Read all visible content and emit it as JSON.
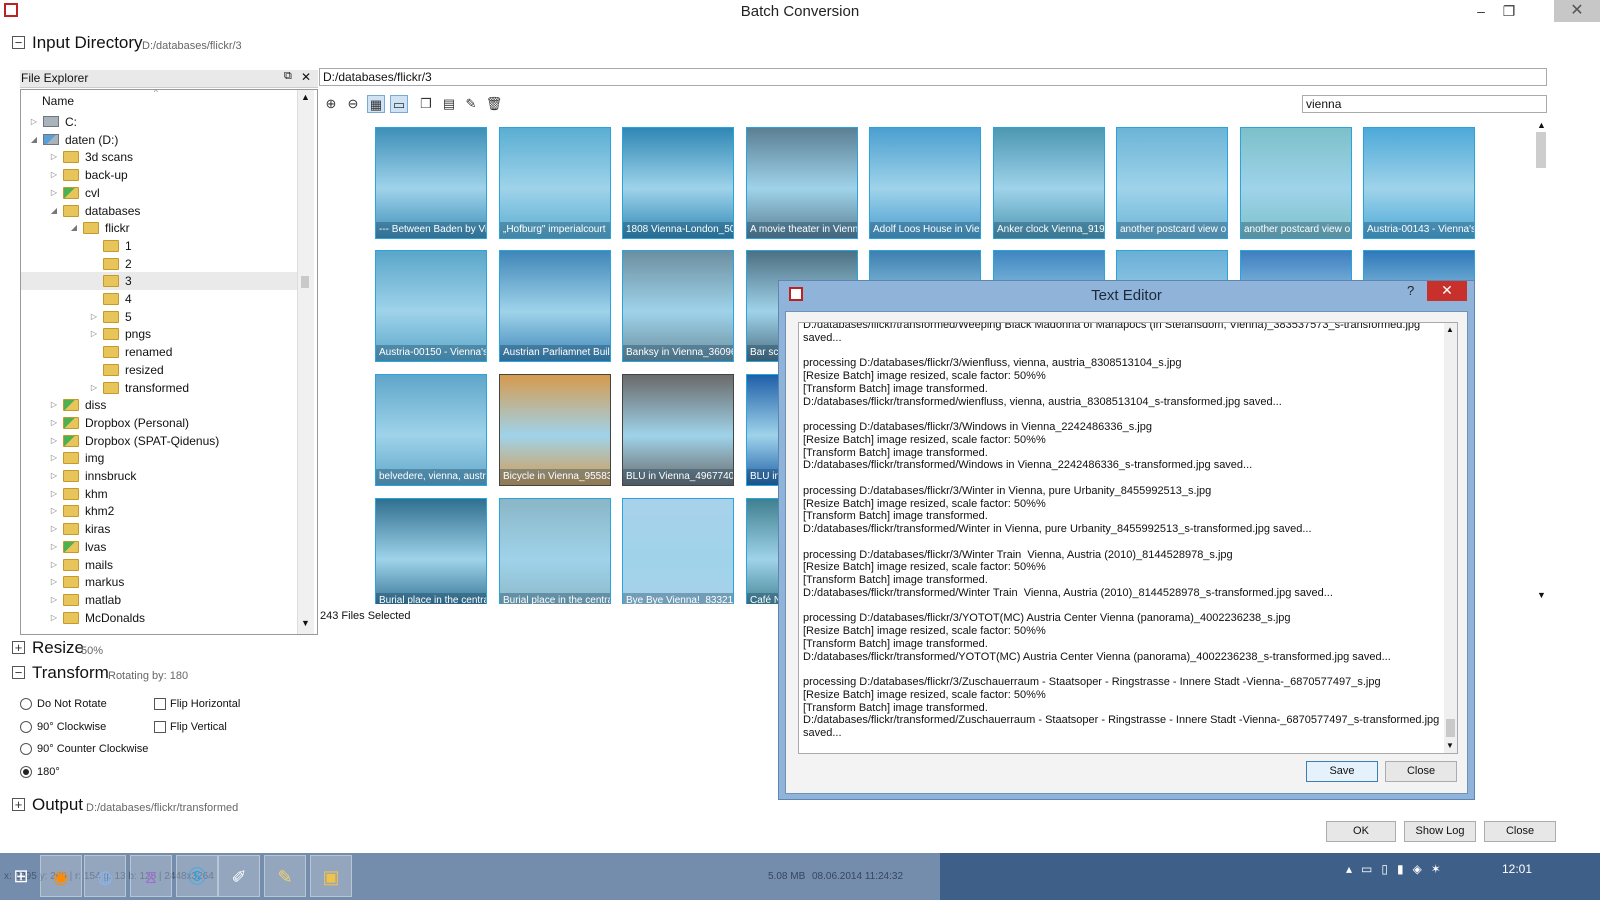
{
  "window": {
    "title": "Batch Conversion",
    "min_label": "–",
    "max_label": "❐",
    "close_label": "✕"
  },
  "sections": {
    "input": {
      "toggle": "−",
      "title": "Input Directory",
      "path": "D:/databases/flickr/3"
    },
    "resize": {
      "toggle": "+",
      "title": "Resize",
      "value": "50%"
    },
    "transform": {
      "toggle": "−",
      "title": "Transform",
      "value": "Rotating by: 180"
    },
    "output": {
      "toggle": "+",
      "title": "Output",
      "path": "D:/databases/flickr/transformed"
    }
  },
  "file_explorer": {
    "title": "File Explorer",
    "column": "Name",
    "items": [
      {
        "label": "C:",
        "icon": "drive-icon",
        "arrow": "▷"
      },
      {
        "label": "daten (D:)",
        "icon": "network-drive-icon",
        "arrow": "◢"
      },
      {
        "label": "3d scans",
        "icon": "folder-icon",
        "arrow": "▷"
      },
      {
        "label": "back-up",
        "icon": "folder-icon",
        "arrow": "▷"
      },
      {
        "label": "cvl",
        "icon": "shared-folder-icon",
        "arrow": "▷"
      },
      {
        "label": "databases",
        "icon": "folder-icon",
        "arrow": "◢"
      },
      {
        "label": "flickr",
        "icon": "folder-icon",
        "arrow": "◢"
      },
      {
        "label": "1",
        "icon": "folder-icon",
        "arrow": ""
      },
      {
        "label": "2",
        "icon": "folder-icon",
        "arrow": ""
      },
      {
        "label": "3",
        "icon": "folder-icon",
        "arrow": ""
      },
      {
        "label": "4",
        "icon": "folder-icon",
        "arrow": ""
      },
      {
        "label": "5",
        "icon": "folder-icon",
        "arrow": "▷"
      },
      {
        "label": "pngs",
        "icon": "folder-icon",
        "arrow": "▷"
      },
      {
        "label": "renamed",
        "icon": "folder-icon",
        "arrow": ""
      },
      {
        "label": "resized",
        "icon": "folder-icon",
        "arrow": ""
      },
      {
        "label": "transformed",
        "icon": "folder-icon",
        "arrow": "▷"
      },
      {
        "label": "diss",
        "icon": "shared-folder-icon",
        "arrow": "▷"
      },
      {
        "label": "Dropbox (Personal)",
        "icon": "dropbox-icon",
        "arrow": "▷"
      },
      {
        "label": "Dropbox (SPAT-Qidenus)",
        "icon": "dropbox-icon",
        "arrow": "▷"
      },
      {
        "label": "img",
        "icon": "folder-icon",
        "arrow": "▷"
      },
      {
        "label": "innsbruck",
        "icon": "folder-icon",
        "arrow": "▷"
      },
      {
        "label": "khm",
        "icon": "folder-icon",
        "arrow": "▷"
      },
      {
        "label": "khm2",
        "icon": "folder-icon",
        "arrow": "▷"
      },
      {
        "label": "kiras",
        "icon": "folder-icon",
        "arrow": "▷"
      },
      {
        "label": "lvas",
        "icon": "shared-folder-icon",
        "arrow": "▷"
      },
      {
        "label": "mails",
        "icon": "folder-icon",
        "arrow": "▷"
      },
      {
        "label": "markus",
        "icon": "folder-icon",
        "arrow": "▷"
      },
      {
        "label": "matlab",
        "icon": "folder-icon",
        "arrow": "▷"
      },
      {
        "label": "McDonalds",
        "icon": "folder-icon",
        "arrow": "▷"
      }
    ]
  },
  "browser": {
    "path": "D:/databases/flickr/3",
    "search": "vienna",
    "files_selected": "243 Files Selected",
    "toolbar_icons": [
      "zoom-in-icon",
      "zoom-out-icon",
      "grid-view-icon",
      "list-view-icon",
      "copy-icon",
      "paste-icon",
      "rename-icon",
      "delete-icon"
    ],
    "thumbnails": [
      "--- Between Baden by Vi",
      "„Hofburg\" imperialcourt",
      "1808 Vienna-London_503",
      "A movie theater in Vienn",
      "Adolf Loos House in Vier",
      "Anker clock Vienna_919(",
      "another postcard view o",
      "another postcard view o",
      "Austria-00143 - Vienna's",
      "Austria-00150 - Vienna's",
      "Austrian Parliamnet Build",
      "Banksy in Vienna_360961",
      "Bar sc",
      "",
      "",
      "",
      "",
      "",
      "belvedere, vienna, austri",
      "Bicycle in Vienna_955832",
      "BLU in Vienna_496774011",
      "BLU in",
      "Burial place in the centra",
      "Burial place in the centra",
      "Bye Bye Vienna!_8332148",
      "Café N"
    ]
  },
  "transform_options": {
    "rotate": [
      "Do Not Rotate",
      "90° Clockwise",
      "90° Counter Clockwise",
      "180°"
    ],
    "selected": "180°",
    "flip": [
      "Flip Horizontal",
      "Flip Vertical"
    ]
  },
  "text_editor": {
    "title": "Text Editor",
    "help": "?",
    "close": "✕",
    "log": "D:/databases/flickr/transformed/Weeping Black Madonna of Mariapocs (in Stefansdom, Vienna)_383537573_s-transformed.jpg\nsaved...\n\nprocessing D:/databases/flickr/3/wienfluss, vienna, austria_8308513104_s.jpg\n[Resize Batch] image resized, scale factor: 50%%\n[Transform Batch] image transformed.\nD:/databases/flickr/transformed/wienfluss, vienna, austria_8308513104_s-transformed.jpg saved...\n\nprocessing D:/databases/flickr/3/Windows in Vienna_2242486336_s.jpg\n[Resize Batch] image resized, scale factor: 50%%\n[Transform Batch] image transformed.\nD:/databases/flickr/transformed/Windows in Vienna_2242486336_s-transformed.jpg saved...\n\nprocessing D:/databases/flickr/3/Winter in Vienna, pure Urbanity_8455992513_s.jpg\n[Resize Batch] image resized, scale factor: 50%%\n[Transform Batch] image transformed.\nD:/databases/flickr/transformed/Winter in Vienna, pure Urbanity_8455992513_s-transformed.jpg saved...\n\nprocessing D:/databases/flickr/3/Winter Train  Vienna, Austria (2010)_8144528978_s.jpg\n[Resize Batch] image resized, scale factor: 50%%\n[Transform Batch] image transformed.\nD:/databases/flickr/transformed/Winter Train  Vienna, Austria (2010)_8144528978_s-transformed.jpg saved...\n\nprocessing D:/databases/flickr/3/YOTOT(MC) Austria Center Vienna (panorama)_4002236238_s.jpg\n[Resize Batch] image resized, scale factor: 50%%\n[Transform Batch] image transformed.\nD:/databases/flickr/transformed/YOTOT(MC) Austria Center Vienna (panorama)_4002236238_s-transformed.jpg saved...\n\nprocessing D:/databases/flickr/3/Zuschauerraum - Staatsoper - Ringstrasse - Innere Stadt -Vienna-_6870577497_s.jpg\n[Resize Batch] image resized, scale factor: 50%%\n[Transform Batch] image transformed.\nD:/databases/flickr/transformed/Zuschauerraum - Staatsoper - Ringstrasse - Innere Stadt -Vienna-_6870577497_s-transformed.jpg\nsaved...",
    "save": "Save",
    "close_btn": "Close"
  },
  "footer_buttons": {
    "ok": "OK",
    "show_log": "Show Log",
    "close": "Close"
  },
  "status_bar": {
    "coords": "x: 2295 y: 269 | r: 154 g: 13 b: 125 | 2448x3264",
    "size": "5.08 MB",
    "date": "08.06.2014 11:24:32"
  },
  "taskbar": {
    "apps": [
      "start-icon",
      "firefox-icon",
      "app-icon",
      "visual-studio-icon",
      "skype-icon",
      "nomacs-icon",
      "notepad-icon",
      "explorer-icon"
    ],
    "clock": "12:01"
  }
}
